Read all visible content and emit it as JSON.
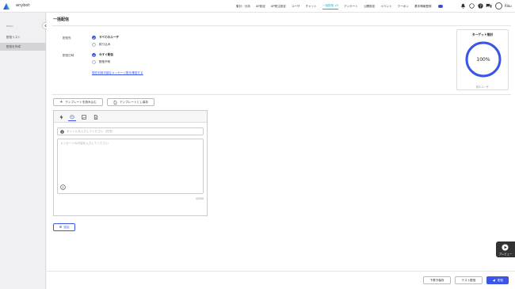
{
  "app": {
    "name": "anybot",
    "brand_color": "#3a56e8",
    "accent_color": "#13b5c9"
  },
  "nav": {
    "items": [
      {
        "label": "集計・分析"
      },
      {
        "label": "AP設定"
      },
      {
        "label": "AP受注設定"
      },
      {
        "label": "ユーザ"
      },
      {
        "label": "チャット"
      },
      {
        "label": "一括配信 V2",
        "active": true
      },
      {
        "label": "アンケート"
      },
      {
        "label": "公開設定"
      },
      {
        "label": "イベント"
      },
      {
        "label": "クーポン"
      },
      {
        "label": "基本情報登録"
      }
    ],
    "badge_count": "9",
    "user_name": "Riku"
  },
  "sidebar": {
    "section": "BMSG",
    "items": [
      {
        "label": "配信リスト"
      },
      {
        "label": "配信を作成",
        "selected": true
      }
    ]
  },
  "page": {
    "title": "一括配信"
  },
  "form": {
    "target_label": "配信先",
    "target_options": [
      {
        "label": "すべてのユーザ",
        "checked": true
      },
      {
        "label": "絞り込み",
        "checked": false
      }
    ],
    "timing_label": "配信日時",
    "timing_options": [
      {
        "label": "今すぐ配信",
        "checked": true
      },
      {
        "label": "配信予約",
        "checked": false
      }
    ],
    "estimate_link": "現在利用可能なメッセージ数を確認する"
  },
  "target_card": {
    "title": "ターゲット推計",
    "percent": "100%",
    "value": 100,
    "subtitle": "約1ユーザ"
  },
  "buttons": {
    "load_template": "テンプレートを読み込む",
    "save_template": "テンプレートとし保存",
    "add": "追加",
    "preview": "プレビュー",
    "save_draft": "下書き保存",
    "test_send": "テスト配信",
    "send": "配信"
  },
  "editor": {
    "title_placeholder": "タイトルを入力してください（任意）",
    "message_placeholder": "メッセージの内容を入力してください",
    "char_count": "0/500",
    "tab_icons": [
      "lightning-icon",
      "chat-bubble-icon",
      "image-icon",
      "document-icon"
    ]
  }
}
